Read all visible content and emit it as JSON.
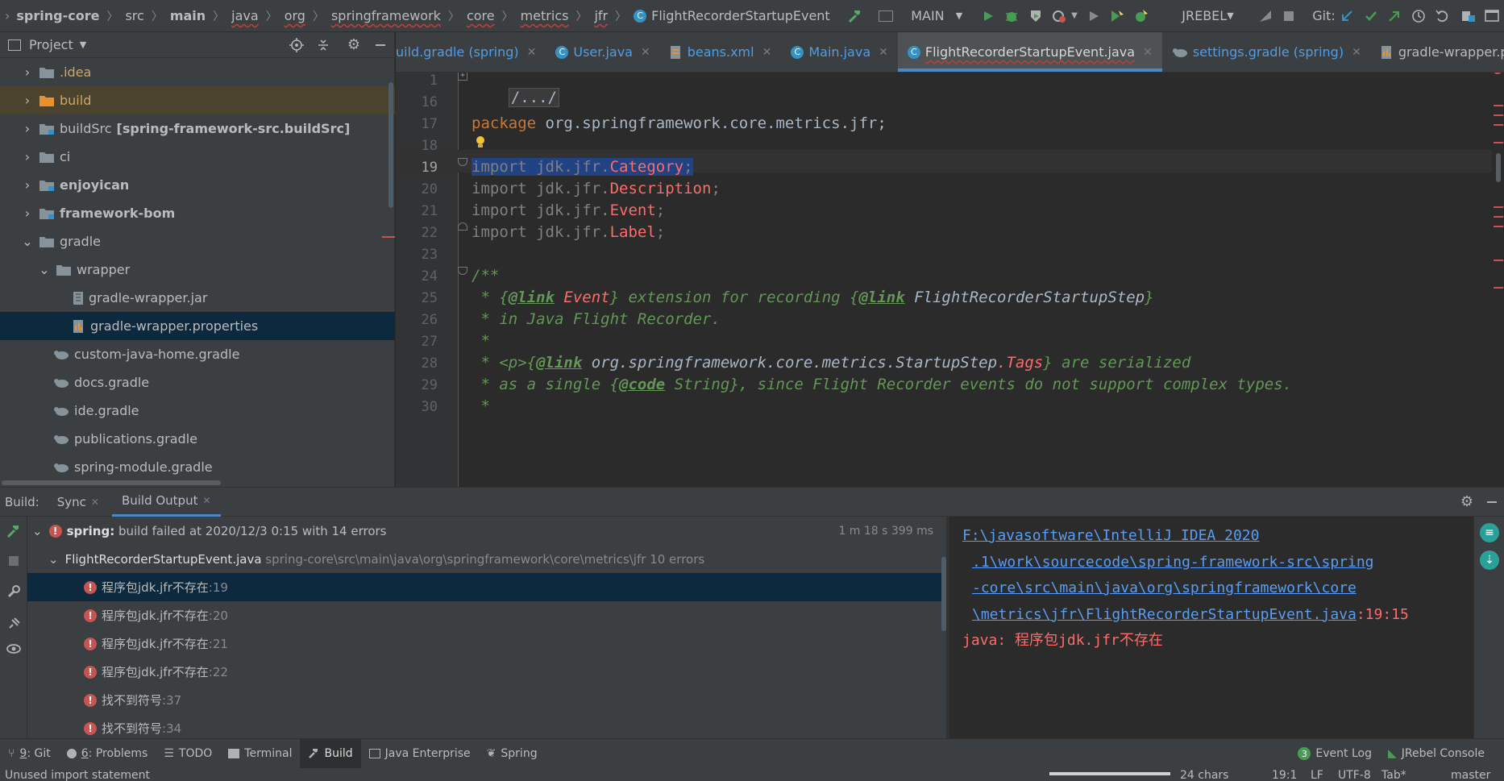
{
  "breadcrumbs": [
    "spring-core",
    "src",
    "main",
    "java",
    "org",
    "springframework",
    "core",
    "metrics",
    "jfr",
    "FlightRecorderStartupEvent"
  ],
  "run_config": "MAIN",
  "jrebel_label": "JREBEL",
  "git_label": "Git:",
  "project_panel": {
    "title": "Project",
    "items": [
      {
        "label": ".idea",
        "color": "#c9a867"
      },
      {
        "label": "build",
        "color": "#c9a867"
      },
      {
        "label": "buildSrc",
        "bold_suffix": "[spring-framework-src.buildSrc]"
      },
      {
        "label": "ci"
      },
      {
        "label": "enjoyican"
      },
      {
        "label": "framework-bom"
      },
      {
        "label": "gradle"
      },
      {
        "label": "wrapper"
      },
      {
        "label": "gradle-wrapper.jar"
      },
      {
        "label": "gradle-wrapper.properties"
      },
      {
        "label": "custom-java-home.gradle"
      },
      {
        "label": "docs.gradle"
      },
      {
        "label": "ide.gradle"
      },
      {
        "label": "publications.gradle"
      },
      {
        "label": "spring-module.gradle"
      }
    ]
  },
  "editor_tabs": [
    {
      "label": "uild.gradle (spring)"
    },
    {
      "label": "User.java"
    },
    {
      "label": "beans.xml"
    },
    {
      "label": "Main.java"
    },
    {
      "label": "FlightRecorderStartupEvent.java",
      "active": true
    },
    {
      "label": "settings.gradle (spring)"
    },
    {
      "label": "gradle-wrapper.properties"
    }
  ],
  "code": {
    "line_numbers": [
      "1",
      "16",
      "17",
      "18",
      "19",
      "20",
      "21",
      "22",
      "23",
      "24",
      "25",
      "26",
      "27",
      "28",
      "29",
      "30"
    ],
    "fold": "/.../",
    "package_kw": "package",
    "package_name": " org.springframework.core.metrics.jfr;",
    "import_kw": "import",
    "import_prefix": " jdk.jfr.",
    "imports": [
      "Category",
      "Description",
      "Event",
      "Label"
    ],
    "javadoc_open": "/**",
    "link_tag": "@link",
    "code_tag": "@code",
    "l25_a": " * {",
    "l25_event": " Event",
    "l25_b": "} extension for recording {",
    "l25_ref": " FlightRecorderStartupStep",
    "l25_c": "}",
    "l26": " * in Java Flight Recorder.",
    "l27": " *",
    "l28_a": " * <p>{",
    "l28_ref": " org.springframework.core.metrics.StartupStep",
    "l28_tags": ".Tags",
    "l28_b": "} are serialized",
    "l29_a": " * as a single {",
    "l29_ref": " String",
    "l29_b": "}, since Flight Recorder events do not support complex types.",
    "l30": " *"
  },
  "build_panel": {
    "label": "Build:",
    "tabs": [
      "Sync",
      "Build Output"
    ],
    "summary_name": "spring:",
    "summary_text": " build failed at 2020/12/3 0:15 with 14 errors",
    "summary_time": "1 m 18 s 399 ms",
    "file_name": "FlightRecorderStartupEvent.java",
    "file_path": " spring-core\\src\\main\\java\\org\\springframework\\core\\metrics\\jfr 10 errors",
    "errors": [
      {
        "text": "程序包jdk.jfr不存在",
        "line": ":19"
      },
      {
        "text": "程序包jdk.jfr不存在",
        "line": ":20"
      },
      {
        "text": "程序包jdk.jfr不存在",
        "line": ":21"
      },
      {
        "text": "程序包jdk.jfr不存在",
        "line": ":22"
      },
      {
        "text": "找不到符号",
        "line": ":37"
      },
      {
        "text": "找不到符号",
        "line": ":34"
      }
    ]
  },
  "console": {
    "path_lines": [
      "F:\\javasoftware\\IntelliJ IDEA 2020",
      ".1\\work\\sourcecode\\spring-framework-src\\spring",
      "-core\\src\\main\\java\\org\\springframework\\core",
      "\\metrics\\jfr\\FlightRecorderStartupEvent.java"
    ],
    "position": ":19:15",
    "error_prefix": "java: ",
    "error_text": "程序包jdk.jfr不存在"
  },
  "tool_windows": [
    {
      "key": "9",
      "label": ": Git"
    },
    {
      "key": "6",
      "label": ": Problems"
    },
    {
      "label": "TODO"
    },
    {
      "label": "Terminal"
    },
    {
      "label": "Build",
      "active": true
    },
    {
      "label": "Java Enterprise"
    },
    {
      "label": "Spring"
    }
  ],
  "event_log": "Event Log",
  "event_log_count": "3",
  "jrebel_console": "JRebel Console",
  "status": {
    "message": "Unused import statement",
    "chars": "24 chars",
    "position": "19:1",
    "line_sep": "LF",
    "encoding": "UTF-8",
    "indent": "Tab*",
    "branch": "master"
  }
}
